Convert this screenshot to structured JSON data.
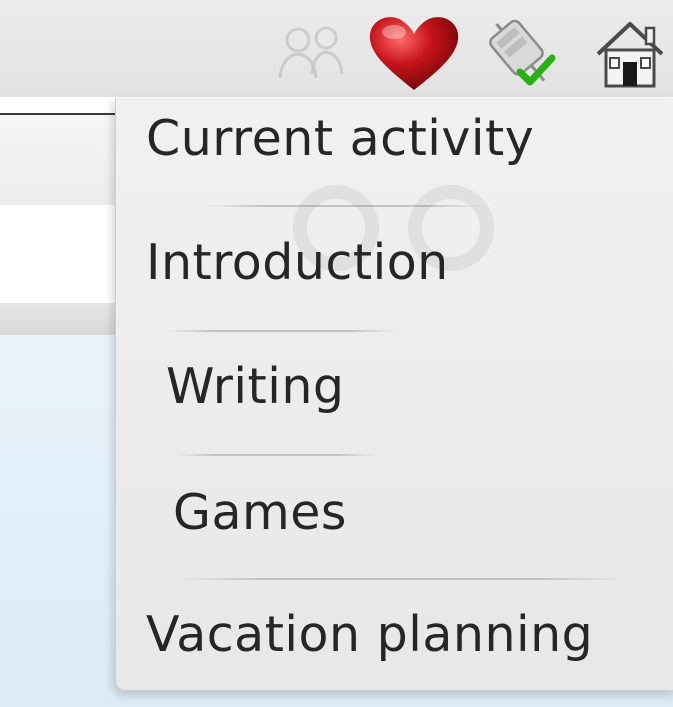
{
  "tray": {
    "icons": [
      "people-icon",
      "heart-icon",
      "connection-status-icon",
      "home-icon"
    ],
    "heart_color": "#c8151b",
    "check_color": "#29b014"
  },
  "menu": {
    "items": [
      {
        "label": "Current activity"
      },
      {
        "label": "Introduction"
      },
      {
        "label": "Writing"
      },
      {
        "label": "Games"
      },
      {
        "label": "Vacation planning"
      }
    ]
  }
}
